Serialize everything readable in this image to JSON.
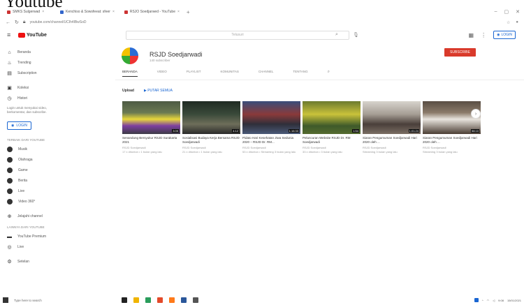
{
  "page_caption": "Youtube",
  "browser": {
    "tabs": [
      {
        "label": "SMKS Sulgerwad",
        "color": "#d33"
      },
      {
        "label": "Kenchiso & Sowsfeeat: sfeer",
        "color": "#3366cc"
      },
      {
        "label": "RSJO Soedjarwed - YouTube",
        "color": "#e11"
      }
    ],
    "new_tab": "+",
    "url": "youtube.com/channel/UCIh4lBwSoD"
  },
  "header": {
    "logo_text": "YouTube",
    "search_placeholder": "Telusuri",
    "signin_label": "LOGIN"
  },
  "sidebar": {
    "nav": [
      {
        "label": "Beranda",
        "icon": "home-icon"
      },
      {
        "label": "Trending",
        "icon": "trending-icon"
      },
      {
        "label": "Subscription",
        "icon": "subscriptions-icon"
      },
      {
        "label": "Koleksi",
        "icon": "library-icon"
      },
      {
        "label": "Histori",
        "icon": "history-icon"
      }
    ],
    "signin_note": "Login untuk menyukai video, berkomentar, dan subscribe.",
    "signin_label": "LOGIN",
    "best_heading": "TERBAIK DARI YOUTUBE",
    "best_items": [
      "Musik",
      "Olahraga",
      "Game",
      "Berita",
      "Live",
      "Video 360°"
    ],
    "browse_label": "Jelajahi channel",
    "more_heading": "LAINNYA DARI YOUTUBE",
    "more_items": [
      "YouTube Premium",
      "Live"
    ],
    "settings_label": "Setelan"
  },
  "channel": {
    "name": "RSJD Soedjarwadi",
    "subscribers": "140 subscriber",
    "subscribe_label": "SUBSCRIBE",
    "tabs": [
      "BERANDA",
      "VIDEO",
      "PLAYLIST",
      "KOMUNITAS",
      "CHANNEL",
      "TENTANG"
    ],
    "uploads_title": "Upload",
    "play_all": "PUTAR SEMUA"
  },
  "videos": [
    {
      "title": "Senandung Bersyukur RSJD Surakarta 2021",
      "channel": "RSJD Soedjarwadi",
      "meta": "17 x ditonton • 1 bulan yang lalu",
      "duration": "3:05"
    },
    {
      "title": "Sosialisasi Budaya Kerja Bersama RSJD Soedjarwadi",
      "channel": "RSJD Soedjarwadi",
      "meta": "21 x ditonton • 1 bulan yang lalu",
      "duration": "4:12"
    },
    {
      "title": "Pidato Hari Kesehatan Jiwa Sedunia 2020 – RSJD Dr. RM...",
      "channel": "RSJD Soedjarwadi",
      "meta": "53 x ditonton • Streaming 3 bulan yang lalu",
      "duration": "1:16:33"
    },
    {
      "title": "Peluncuran Website RSJD Dr. RM Soedjarwadi",
      "channel": "RSJD Soedjarwadi",
      "meta": "33 x ditonton • 3 bulan yang lalu",
      "duration": "1:54"
    },
    {
      "title": "Siaran Pengumuman Soedjarwadi Hari 2020 oleh ...",
      "channel": "RSJD Soedjarwadi",
      "meta": "Streaming 3 bulan yang lalu",
      "duration": "1:01:24"
    },
    {
      "title": "Siaran Pengumuman Soedjarwadi Hari 2020 oleh ...",
      "channel": "RSJD Soedjarwadi",
      "meta": "Streaming 3 bulan yang lalu",
      "duration": "58:10"
    }
  ],
  "taskbar": {
    "search_placeholder": "Type here to search",
    "time": "9:08",
    "date": "15/01/2021"
  }
}
